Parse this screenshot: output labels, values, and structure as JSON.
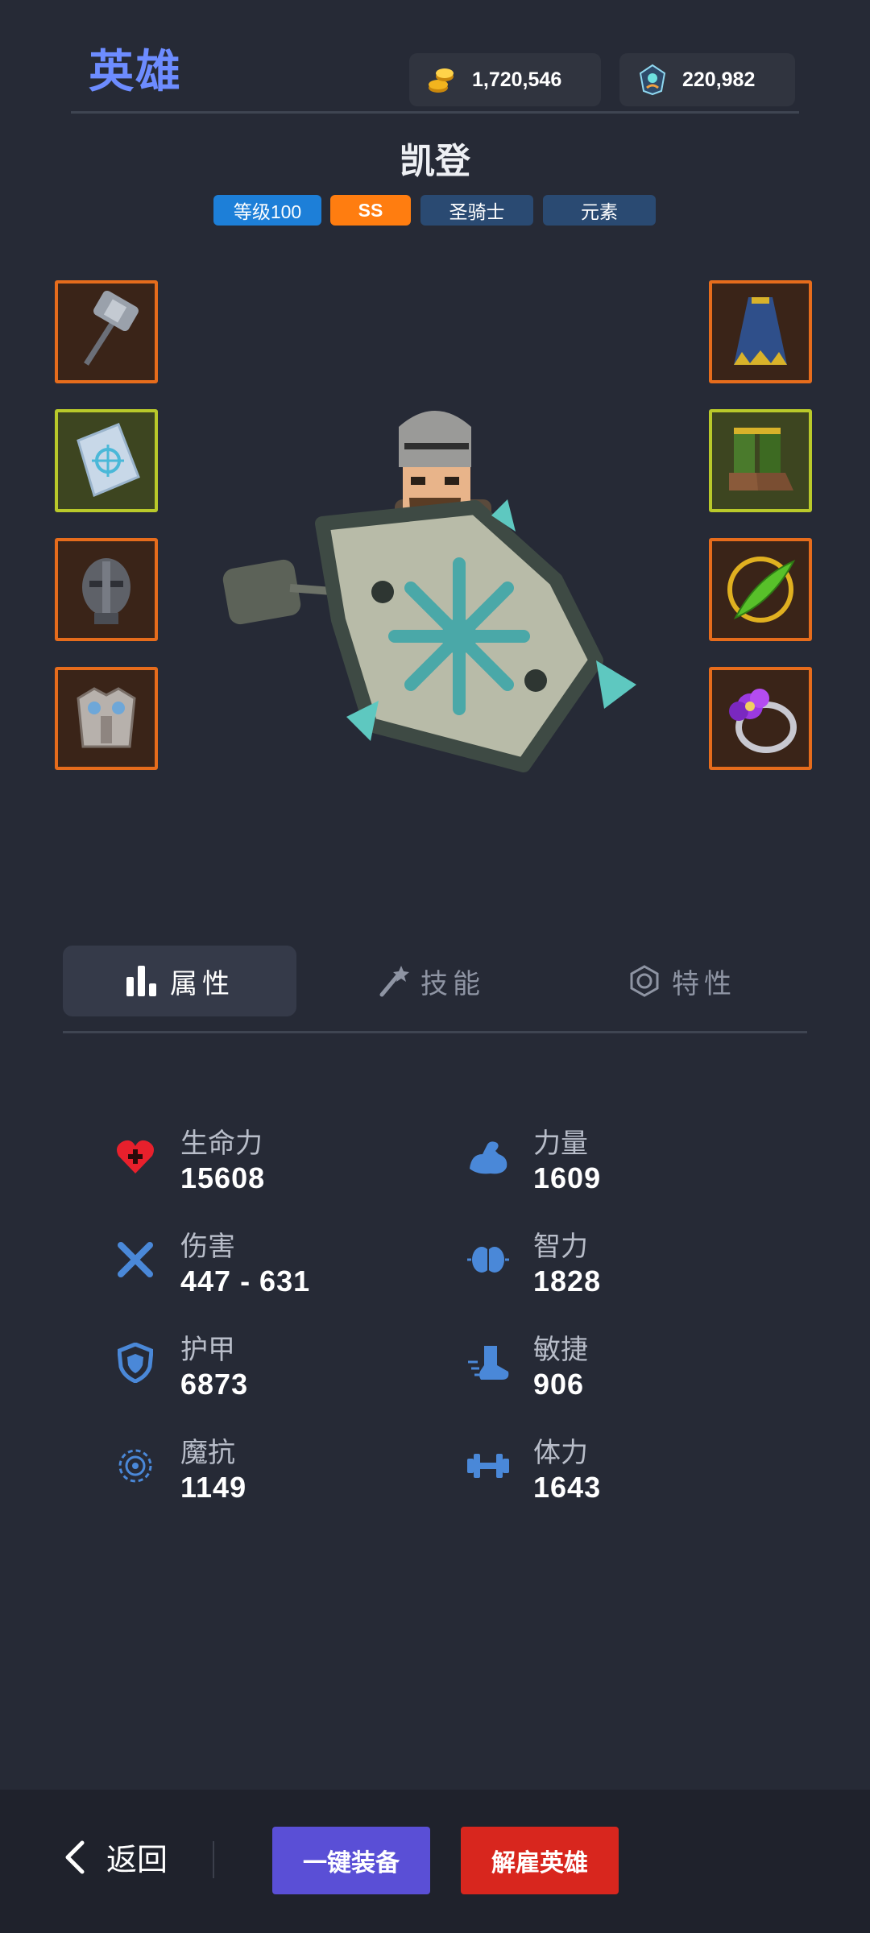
{
  "header": {
    "title": "英雄"
  },
  "currency": {
    "gold": "1,720,546",
    "gems": "220,982"
  },
  "hero": {
    "name": "凯登",
    "tags": {
      "level": "等级100",
      "rank": "SS",
      "class": "圣骑士",
      "element": "元素"
    }
  },
  "equipment": {
    "left": [
      "hammer-icon",
      "frost-shield-icon",
      "helmet-icon",
      "chest-armor-icon"
    ],
    "right": [
      "cloak-icon",
      "boots-icon",
      "leaf-ring-icon",
      "amethyst-ring-icon"
    ]
  },
  "tabs": {
    "attributes": "属性",
    "skills": "技能",
    "traits": "特性"
  },
  "stats": {
    "hp": {
      "label": "生命力",
      "value": "15608"
    },
    "damage": {
      "label": "伤害",
      "value": "447 - 631"
    },
    "armor": {
      "label": "护甲",
      "value": "6873"
    },
    "magic_resist": {
      "label": "魔抗",
      "value": "1149"
    },
    "strength": {
      "label": "力量",
      "value": "1609"
    },
    "intellect": {
      "label": "智力",
      "value": "1828"
    },
    "agility": {
      "label": "敏捷",
      "value": "906"
    },
    "stamina": {
      "label": "体力",
      "value": "1643"
    }
  },
  "footer": {
    "back": "返回",
    "auto_equip": "一键装备",
    "dismiss": "解雇英雄"
  },
  "colors": {
    "background": "#262a36",
    "accent": "#6d8cff",
    "stat_icon": "#4a88d8",
    "hp_icon": "#e8202c",
    "rank_tag": "#ff7d10"
  }
}
